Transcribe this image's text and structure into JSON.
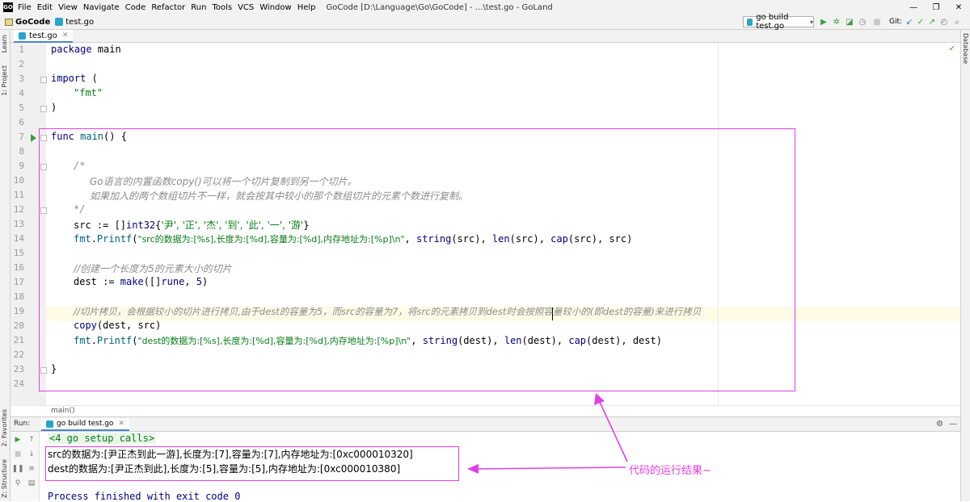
{
  "window": {
    "app_icon": "GO",
    "menu": [
      "File",
      "Edit",
      "View",
      "Navigate",
      "Code",
      "Refactor",
      "Run",
      "Tools",
      "VCS",
      "Window",
      "Help"
    ],
    "title": "GoCode [D:\\Language\\Go\\GoCode] - ...\\test.go - GoLand",
    "controls": [
      "—",
      "❐",
      "✕"
    ]
  },
  "navbar": {
    "project": "GoCode",
    "file": "test.go",
    "run_config": "go build test.go",
    "git_label": "Git:"
  },
  "left_strip": {
    "learn": "Learn",
    "project": "1: Project",
    "favorites": "2: Favorites",
    "structure": "Z: Structure"
  },
  "right_strip": {
    "database": "Database"
  },
  "editor": {
    "tab_label": "test.go",
    "breadcrumb": "main()",
    "line_numbers": [
      "1",
      "2",
      "3",
      "4",
      "5",
      "6",
      "7",
      "8",
      "9",
      "10",
      "11",
      "12",
      "13",
      "14",
      "15",
      "16",
      "17",
      "18",
      "19",
      "20",
      "21",
      "22",
      "23",
      "24"
    ],
    "code": {
      "l1_kw": "package",
      "l1_name": " main",
      "l3_kw": "import",
      "l3_rest": " (",
      "l4": "\"fmt\"",
      "l5": ")",
      "l7_kw": "func",
      "l7_name": " main",
      "l7_rest": "() {",
      "l9": "/*",
      "l10": "Go语言的内置函数copy()可以将一个切片复制到另一个切片。",
      "l11": "如果加入的两个数组切片不一样，就会按其中较小的那个数组切片的元素个数进行复制。",
      "l12": "*/",
      "l13_a": "src := []",
      "l13_b": "int32",
      "l13_c": "{",
      "l13_d": "'尹', '正', '杰', '到', '此', '一', '游'",
      "l13_e": "}",
      "l14_a": "fmt",
      "l14_b": ".",
      "l14_c": "Printf",
      "l14_d": "(",
      "l14_e": "\"src的数据为:[%s],长度为:[%d],容量为:[%d],内存地址为:[%p]\\n\"",
      "l14_f": ", ",
      "l14_g": "string",
      "l14_h": "(src), ",
      "l14_i": "len",
      "l14_j": "(src), ",
      "l14_k": "cap",
      "l14_l": "(src), src)",
      "l16": "//创建一个长度为5的元素大小的切片",
      "l17_a": "dest := ",
      "l17_b": "make",
      "l17_c": "([]",
      "l17_d": "rune",
      "l17_e": ", ",
      "l17_f": "5",
      "l17_g": ")",
      "l19": "//切片拷贝，会根据较小的切片进行拷贝,由于dest的容量为5，而src的容量为7，将src的元素拷贝到dest时会按照容量较小的(即dest的容量)来进行拷贝",
      "l20_a": "copy",
      "l20_b": "(dest, src)",
      "l21_a": "fmt",
      "l21_b": ".",
      "l21_c": "Printf",
      "l21_d": "(",
      "l21_e": "\"dest的数据为:[%s],长度为:[%d],容量为:[%d],内存地址为:[%p]\\n\"",
      "l21_f": ", ",
      "l21_g": "string",
      "l21_h": "(dest), ",
      "l21_i": "len",
      "l21_j": "(dest), ",
      "l21_k": "cap",
      "l21_l": "(dest), dest)",
      "l23": "}"
    }
  },
  "run_panel": {
    "label": "Run:",
    "tab": "go build test.go",
    "setup_calls": "<4 go setup calls>",
    "output_src": "src的数据为:[尹正杰到此一游],长度为:[7],容量为:[7],内存地址为:[0xc000010320]",
    "output_dest": "dest的数据为:[尹正杰到此],长度为:[5],容量为:[5],内存地址为:[0xc000010380]",
    "exit": "Process finished with exit code 0"
  },
  "annotation": {
    "label": "代码的运行结果~",
    "color": "#e13fe6"
  },
  "colors": {
    "keyword": "#000080",
    "string": "#067d17",
    "function": "#00627a",
    "comment": "#8c8c8c"
  }
}
